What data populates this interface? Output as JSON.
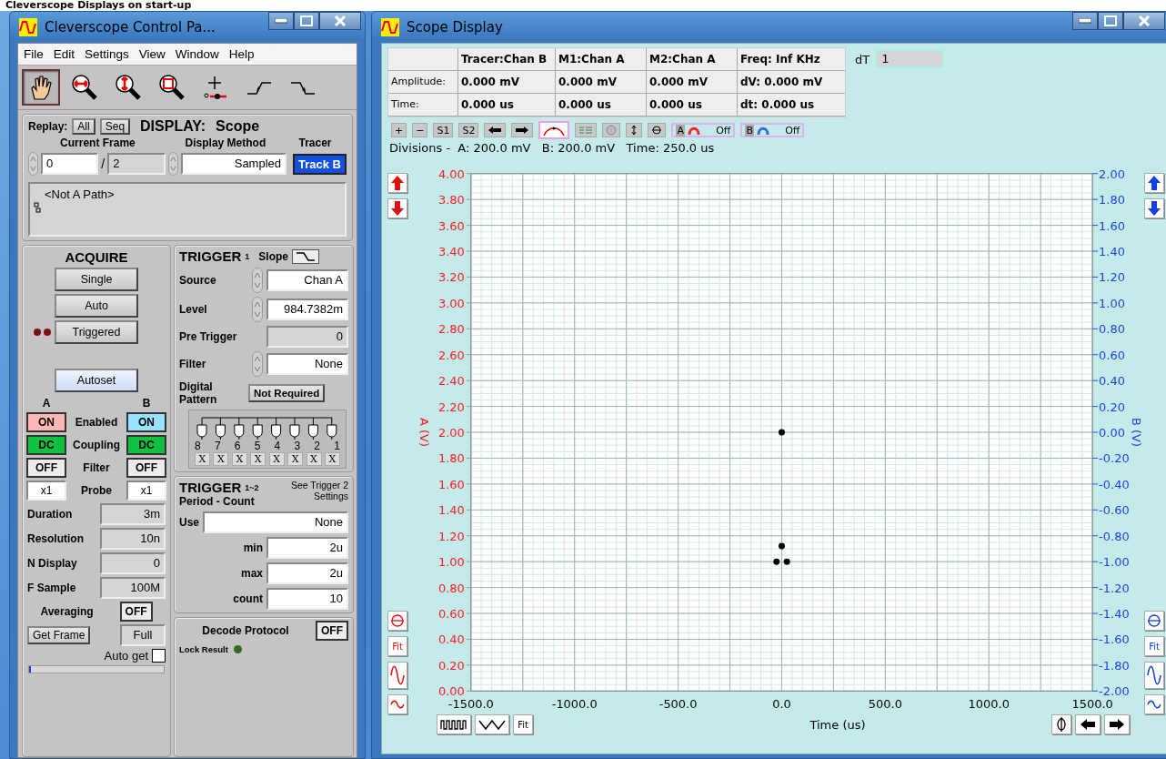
{
  "caption": "Cleverscope Displays on start-up",
  "control_window": {
    "title": "Cleverscope Control Pa...",
    "menu": [
      {
        "label": "File"
      },
      {
        "label": "Edit"
      },
      {
        "label": "Settings"
      },
      {
        "label": "View"
      },
      {
        "label": "Window"
      },
      {
        "label": "Help"
      }
    ],
    "tools": [
      {
        "kind": "hand",
        "selected": true
      },
      {
        "kind": "zoom-horizontal",
        "selected": false
      },
      {
        "kind": "zoom-vertical",
        "selected": false
      },
      {
        "kind": "zoom-box",
        "selected": false
      },
      {
        "kind": "cursor",
        "selected": false
      },
      {
        "kind": "rising-edge",
        "selected": false
      },
      {
        "kind": "falling-edge",
        "selected": false
      }
    ],
    "display": {
      "replay_label": "Replay:",
      "replay_buttons": [
        "All",
        "Seq"
      ],
      "heading": "DISPLAY:",
      "mode": "Scope",
      "frame_label": "Current Frame",
      "frame": "0",
      "frame_sep": "/",
      "frame_total": "2",
      "method_label": "Display Method",
      "method": "Sampled",
      "tracer_label": "Tracer",
      "tracer": "Track B",
      "path": "<Not A Path>"
    },
    "acquire": {
      "title": "ACQUIRE",
      "buttons": [
        "Single",
        "Auto",
        "Triggered"
      ],
      "leds": [
        {
          "on": false
        },
        {
          "on": false
        }
      ],
      "autoset": "Autoset",
      "channel_headers": [
        "A",
        "B"
      ],
      "channel_rows": [
        {
          "kind": "on",
          "label": "Enabled",
          "a": "ON",
          "b": "ON"
        },
        {
          "kind": "coupling",
          "label": "Coupling",
          "a": "DC",
          "b": "DC"
        },
        {
          "kind": "off",
          "label": "Filter",
          "a": "OFF",
          "b": "OFF"
        },
        {
          "kind": "field",
          "label": "Probe",
          "a": "x1",
          "b": "x1"
        }
      ],
      "params": [
        {
          "label": "Duration",
          "value": "3m"
        },
        {
          "label": "Resolution",
          "value": "10n"
        },
        {
          "label": "N Display",
          "value": "0"
        },
        {
          "label": "F Sample",
          "value": "100M"
        }
      ],
      "averaging_label": "Averaging",
      "averaging": "OFF",
      "get_frame": "Get Frame",
      "frame_mode": "Full",
      "auto_get": {
        "label": "Auto get",
        "checked": false
      },
      "progress": {
        "level": 0.01
      }
    },
    "trigger": {
      "title": "TRIGGER",
      "number": "1",
      "slope_label": "Slope",
      "rows": [
        {
          "kind": "spin",
          "label": "Source",
          "value": "Chan A"
        },
        {
          "kind": "spin",
          "label": "Level",
          "value": "984.7382m"
        },
        {
          "kind": "readonly",
          "label": "Pre Trigger",
          "value": "0"
        },
        {
          "kind": "spin",
          "label": "Filter",
          "value": "None"
        }
      ],
      "pattern_label": "Digital Pattern",
      "pattern_button": "Not Required",
      "bits": [
        {
          "label": "8",
          "value": "X"
        },
        {
          "label": "7",
          "value": "X"
        },
        {
          "label": "6",
          "value": "X"
        },
        {
          "label": "5",
          "value": "X"
        },
        {
          "label": "4",
          "value": "X"
        },
        {
          "label": "3",
          "value": "X"
        },
        {
          "label": "2",
          "value": "X"
        },
        {
          "label": "1",
          "value": "X"
        }
      ]
    },
    "trigger2": {
      "title": "TRIGGER",
      "number": "1~2",
      "note": "See Trigger 2 Settings",
      "subtitle": "Period - Count",
      "use_label": "Use",
      "use": "None",
      "rows": [
        {
          "label": "min",
          "value": "2u"
        },
        {
          "label": "max",
          "value": "2u"
        },
        {
          "label": "count",
          "value": "10"
        }
      ]
    },
    "decode": {
      "label": "Decode Protocol",
      "value": "OFF",
      "lock_label": "Lock Result",
      "lock_on": false
    }
  },
  "scope_window": {
    "title": "Scope Display",
    "table": {
      "columns": [
        "",
        "Tracer:Chan B",
        "M1:Chan A",
        "M2:Chan A",
        "Freq: Inf KHz"
      ],
      "rows": [
        [
          "Amplitude:",
          "0.000 mV",
          "0.000 mV",
          "0.000 mV",
          "dV: 0.000 mV"
        ],
        [
          "Time:",
          "0.000 us",
          "0.000 us",
          "0.000 us",
          "dt:  0.000 us"
        ]
      ]
    },
    "dt_label": "dT",
    "dt": "1",
    "toolbar": [
      {
        "kind": "text",
        "label": "+"
      },
      {
        "kind": "text",
        "label": "−"
      },
      {
        "kind": "text",
        "label": "S1"
      },
      {
        "kind": "text",
        "label": "S2"
      },
      {
        "kind": "arrow-left"
      },
      {
        "kind": "arrow-right"
      },
      {
        "kind": "peak"
      },
      {
        "kind": "lines"
      },
      {
        "kind": "ball"
      },
      {
        "kind": "center"
      },
      {
        "kind": "expand"
      },
      {
        "kind": "channel",
        "label": "A",
        "value": "Off",
        "color": "#ff2020"
      },
      {
        "kind": "channel",
        "label": "B",
        "value": "Off",
        "color": "#2a6ee0"
      }
    ],
    "divisions": "Divisions -  A: 200.0 mV   B: 200.0 mV   Time: 250.0 us",
    "left_top_buttons": [
      {
        "kind": "arrow-up"
      },
      {
        "kind": "arrow-down"
      }
    ],
    "left_bottom_buttons": [
      {
        "kind": "target"
      },
      {
        "kind": "fit",
        "label": "Fit"
      },
      {
        "kind": "sine"
      },
      {
        "kind": "wave"
      }
    ],
    "right_top_buttons": [
      {
        "kind": "arrow-up"
      },
      {
        "kind": "arrow-down"
      }
    ],
    "right_bottom_buttons": [
      {
        "kind": "target"
      },
      {
        "kind": "fit",
        "label": "Fit"
      },
      {
        "kind": "sine"
      },
      {
        "kind": "wave"
      }
    ],
    "bottom_left_buttons": [
      {
        "kind": "square-wave"
      },
      {
        "kind": "triangle-wave"
      },
      {
        "kind": "fit",
        "label": "Fit"
      }
    ],
    "bottom_right_buttons": [
      {
        "kind": "phase"
      },
      {
        "kind": "arrow-left"
      },
      {
        "kind": "arrow-right"
      }
    ],
    "b_axis": {
      "label": "B (V)",
      "ticks": [
        "2.00",
        "1.80",
        "1.60",
        "1.40",
        "1.20",
        "1.00",
        "0.80",
        "0.60",
        "0.40",
        "0.20",
        "0.00",
        "-0.20",
        "-0.40",
        "-0.60",
        "-0.80",
        "-1.00",
        "-1.20",
        "-1.40",
        "-1.60",
        "-1.80",
        "-2.00"
      ]
    },
    "chart_data": {
      "type": "scatter",
      "xlabel": "Time (us)",
      "ylabel": "A (V)",
      "xlim": [
        -1500,
        1500
      ],
      "ylim": [
        0,
        4
      ],
      "xticks": [
        {
          "value": -1500,
          "label": "-1500.0"
        },
        {
          "value": -1000,
          "label": "-1000.0"
        },
        {
          "value": -500,
          "label": "-500.0"
        },
        {
          "value": 0,
          "label": "0.0"
        },
        {
          "value": 500,
          "label": "500.0"
        },
        {
          "value": 1000,
          "label": "1000.0"
        },
        {
          "value": 1500,
          "label": "1500.0"
        }
      ],
      "yticks": [
        {
          "value": 0,
          "label": "0.00"
        },
        {
          "value": 0.2,
          "label": "0.20"
        },
        {
          "value": 0.4,
          "label": "0.40"
        },
        {
          "value": 0.6,
          "label": "0.60"
        },
        {
          "value": 0.8,
          "label": "0.80"
        },
        {
          "value": 1,
          "label": "1.00"
        },
        {
          "value": 1.2,
          "label": "1.20"
        },
        {
          "value": 1.4,
          "label": "1.40"
        },
        {
          "value": 1.6,
          "label": "1.60"
        },
        {
          "value": 1.8,
          "label": "1.80"
        },
        {
          "value": 2,
          "label": "2.00"
        },
        {
          "value": 2.2,
          "label": "2.20"
        },
        {
          "value": 2.4,
          "label": "2.40"
        },
        {
          "value": 2.6,
          "label": "2.60"
        },
        {
          "value": 2.8,
          "label": "2.80"
        },
        {
          "value": 3,
          "label": "3.00"
        },
        {
          "value": 3.2,
          "label": "3.20"
        },
        {
          "value": 3.4,
          "label": "3.40"
        },
        {
          "value": 3.6,
          "label": "3.60"
        },
        {
          "value": 3.8,
          "label": "3.80"
        },
        {
          "value": 4,
          "label": "4.00"
        }
      ],
      "x": [
        0,
        -25,
        25,
        0
      ],
      "grid": true,
      "series": [
        {
          "color": "#000000",
          "values": [
            2.0,
            1.0,
            1.0,
            1.12
          ]
        }
      ]
    }
  }
}
